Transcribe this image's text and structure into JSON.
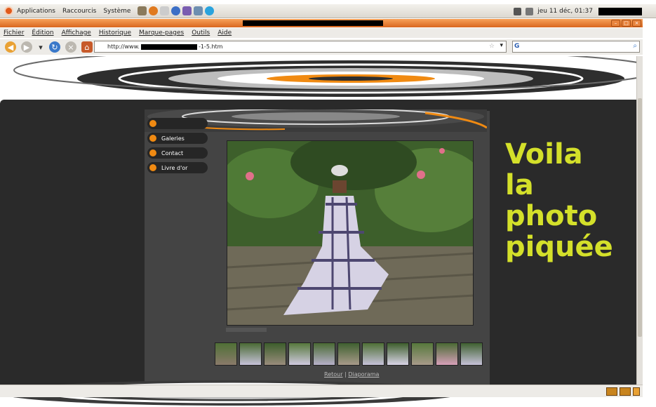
{
  "panel": {
    "applications": "Applications",
    "shortcuts": "Raccourcis",
    "system": "Système",
    "clock": "jeu 11 déc, 01:37"
  },
  "menubar": {
    "items": [
      "Fichier",
      "Édition",
      "Affichage",
      "Historique",
      "Marque-pages",
      "Outils",
      "Aide"
    ]
  },
  "url": {
    "prefix": "http://www.",
    "suffix": "-1-5.htm"
  },
  "site_nav": {
    "items": [
      "Galeries",
      "Contact",
      "Livre d'or"
    ]
  },
  "footer": {
    "back": "Retour",
    "separator": "|",
    "slideshow": "Diaporama"
  },
  "annotation": {
    "lines": [
      "Voila",
      "la",
      "photo",
      "piquée"
    ]
  },
  "colors": {
    "accent_orange": "#f08a12",
    "annotation_yellow": "#d4e02a",
    "page_dark": "#2a2a2a"
  }
}
